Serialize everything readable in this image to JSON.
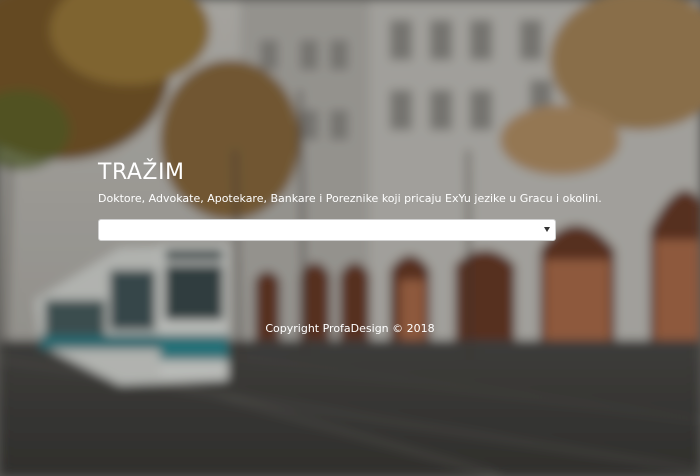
{
  "hero": {
    "title": "TRAŽIM",
    "subtitle": "Doktore, Advokate, Apotekare, Bankare i Poreznike koji pricaju ExYu jezike u Gracu i okolini.",
    "select": {
      "value": "",
      "icon": "chevron-down-icon"
    }
  },
  "footer": {
    "copyright": "Copyright ProfaDesign © 2018"
  },
  "colors": {
    "text": "#ffffff",
    "select_background": "#ffffff"
  }
}
